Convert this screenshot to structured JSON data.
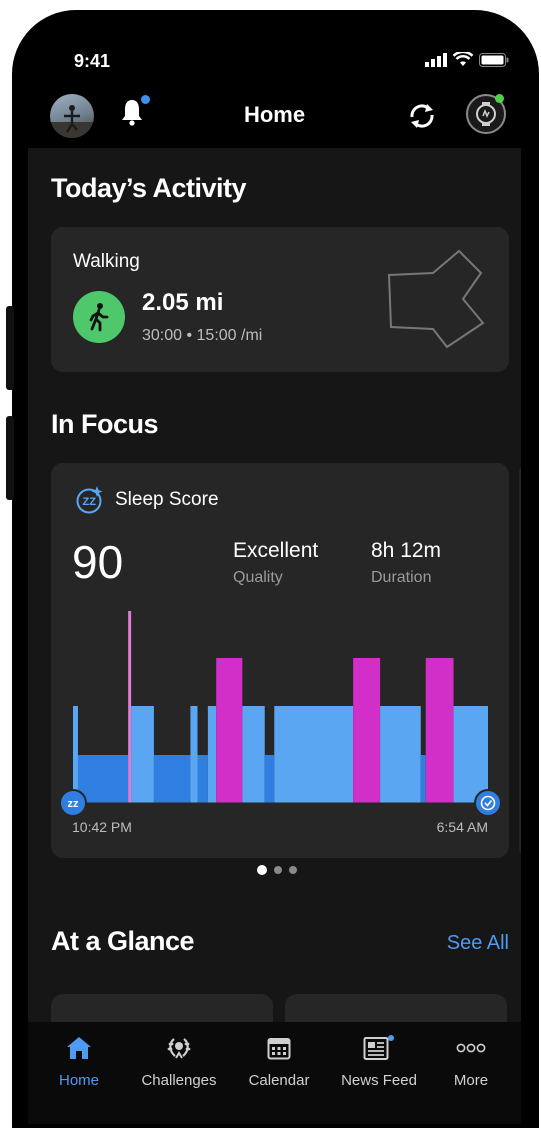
{
  "status": {
    "time": "9:41"
  },
  "header": {
    "title": "Home"
  },
  "activity": {
    "section_title": "Today’s Activity",
    "type": "Walking",
    "distance": "2.05 mi",
    "details": "30:00 • 15:00 /mi"
  },
  "focus": {
    "section_title": "In Focus",
    "sleep": {
      "title": "Sleep Score",
      "score": "90",
      "quality_value": "Excellent",
      "quality_label": "Quality",
      "duration_value": "8h 12m",
      "duration_label": "Duration",
      "start_time": "10:42 PM",
      "end_time": "6:54 AM"
    },
    "pager": {
      "pages": 3,
      "active": 1
    }
  },
  "glance": {
    "section_title": "At a Glance",
    "see_all": "See All"
  },
  "tabs": [
    {
      "label": "Home",
      "icon": "home-icon",
      "active": true
    },
    {
      "label": "Challenges",
      "icon": "laurel-icon",
      "active": false
    },
    {
      "label": "Calendar",
      "icon": "calendar-icon",
      "active": false
    },
    {
      "label": "News Feed",
      "icon": "newsfeed-icon",
      "active": false
    },
    {
      "label": "More",
      "icon": "more-icon",
      "active": false
    }
  ],
  "colors": {
    "accent": "#4f9bf0",
    "walk_green": "#4ec86a",
    "deep_sleep": "#2f7ee0",
    "light_sleep": "#5aa6f2",
    "rem": "#d22ec8",
    "awake": "#e27ad6",
    "notification": "#3d8ff2",
    "watch_connected": "#4fd14a"
  },
  "chart_data": {
    "type": "bar",
    "title": "Sleep Score",
    "x": [
      "10:42 PM",
      "6:54 AM"
    ],
    "stages": [
      "deep",
      "light",
      "rem",
      "awake"
    ],
    "segments": [
      {
        "stage": "light",
        "start": 0.0,
        "end": 0.012
      },
      {
        "stage": "deep",
        "start": 0.012,
        "end": 0.133
      },
      {
        "stage": "awake",
        "start": 0.133,
        "end": 0.14
      },
      {
        "stage": "light",
        "start": 0.14,
        "end": 0.195
      },
      {
        "stage": "deep",
        "start": 0.195,
        "end": 0.283
      },
      {
        "stage": "light",
        "start": 0.283,
        "end": 0.3
      },
      {
        "stage": "deep",
        "start": 0.3,
        "end": 0.325
      },
      {
        "stage": "light",
        "start": 0.325,
        "end": 0.345
      },
      {
        "stage": "rem",
        "start": 0.345,
        "end": 0.408
      },
      {
        "stage": "light",
        "start": 0.408,
        "end": 0.462
      },
      {
        "stage": "deep",
        "start": 0.462,
        "end": 0.485
      },
      {
        "stage": "light",
        "start": 0.485,
        "end": 0.675
      },
      {
        "stage": "rem",
        "start": 0.675,
        "end": 0.74
      },
      {
        "stage": "light",
        "start": 0.74,
        "end": 0.838
      },
      {
        "stage": "deep",
        "start": 0.838,
        "end": 0.85
      },
      {
        "stage": "rem",
        "start": 0.85,
        "end": 0.917
      },
      {
        "stage": "light",
        "start": 0.917,
        "end": 1.0
      }
    ]
  }
}
